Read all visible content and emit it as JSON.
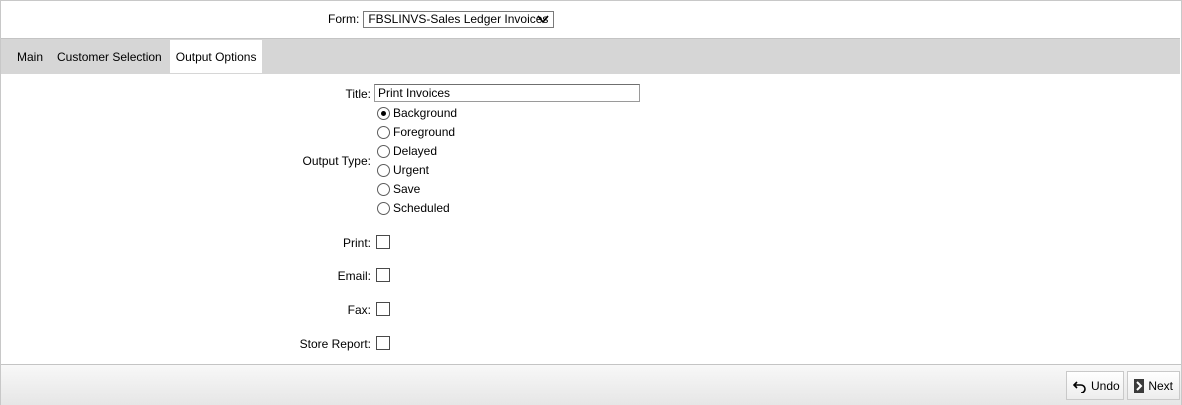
{
  "header": {
    "form_label": "Form:",
    "form_value": "FBSLINVS-Sales Ledger Invoices"
  },
  "tabs": [
    {
      "label": "Main",
      "active": false
    },
    {
      "label": "Customer Selection",
      "active": false
    },
    {
      "label": "Output Options",
      "active": true
    }
  ],
  "fields": {
    "title_label": "Title:",
    "title_value": "Print Invoices",
    "output_type_label": "Output Type:",
    "output_types": [
      {
        "label": "Background",
        "checked": true
      },
      {
        "label": "Foreground",
        "checked": false
      },
      {
        "label": "Delayed",
        "checked": false
      },
      {
        "label": "Urgent",
        "checked": false
      },
      {
        "label": "Save",
        "checked": false
      },
      {
        "label": "Scheduled",
        "checked": false
      }
    ],
    "print_label": "Print:",
    "print_checked": false,
    "email_label": "Email:",
    "email_checked": false,
    "fax_label": "Fax:",
    "fax_checked": false,
    "store_report_label": "Store Report:",
    "store_report_checked": false
  },
  "footer": {
    "undo_label": "Undo",
    "next_label": "Next"
  },
  "icons": {
    "undo": "undo-arrow-icon",
    "next": "chevron-right-icon",
    "select": "chevron-down-icon"
  }
}
